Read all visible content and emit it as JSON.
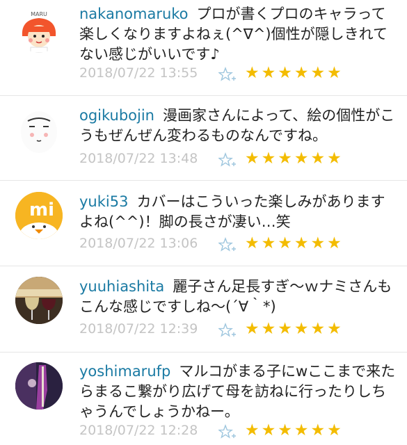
{
  "accent_colors": {
    "username": "#1a7aa3",
    "timestamp": "#c4c4c4",
    "star": "#f3bc00",
    "fav_icon": "#9ec6de"
  },
  "comments": [
    {
      "username": "nakanomaruko",
      "message": "プロが書くプロのキャラって楽しくなりますよねぇ(^∇^)個性が隠しきれてない感じがいいです♪",
      "timestamp": "2018/07/22 13:55",
      "stars": "★★★★★★",
      "avatar_text": "MARU"
    },
    {
      "username": "ogikubojin",
      "message": "漫画家さんによって、絵の個性がこうもぜんぜん変わるものなんですね。",
      "timestamp": "2018/07/22 13:48",
      "stars": "★★★★★★"
    },
    {
      "username": "yuki53",
      "message": "カバーはこういった楽しみがありますよね(^^)！脚の長さが凄い…笑",
      "timestamp": "2018/07/22 13:06",
      "stars": "★★★★★★",
      "avatar_text": "mi"
    },
    {
      "username": "yuuhiashita",
      "message": "麗子さん足長すぎ〜ｗナミさんもこんな感じですしね〜(´∀｀*)",
      "timestamp": "2018/07/22 12:39",
      "stars": "★★★★★★"
    },
    {
      "username": "yoshimarufp",
      "message": "マルコがまる子にwここまで来たらまるこ繋がり広げて母を訪ねに行ったりしちゃうんでしょうかねー。",
      "timestamp": "2018/07/22 12:28",
      "stars": "★★★★★★"
    }
  ]
}
